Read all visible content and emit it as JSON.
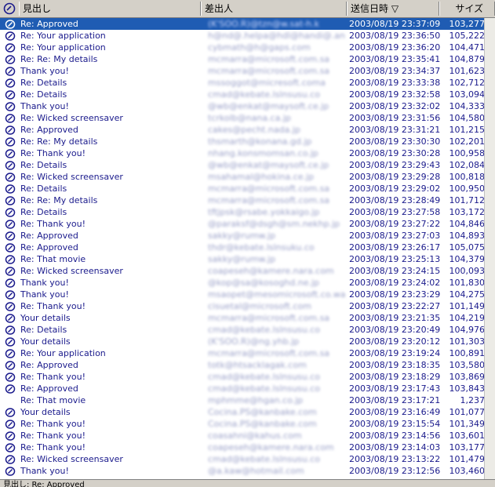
{
  "columns": {
    "subject": "見出し",
    "from": "差出人",
    "date": "送信日時 ▽",
    "size": "サイズ"
  },
  "rows": [
    {
      "subject": "Re: Approved",
      "from": "(K'SOO.R)@tzn@w.sat-h.k",
      "date": "2003/08/19 23:37:09",
      "size": "103,277",
      "selected": true
    },
    {
      "subject": "Re: Your application",
      "from": "h@nd@.helpa@hdl@handi@.ank.k",
      "date": "2003/08/19 23:36:50",
      "size": "105,222"
    },
    {
      "subject": "Re: Your application",
      "from": "cybmath@h@gaps.com",
      "date": "2003/08/19 23:36:20",
      "size": "104,471"
    },
    {
      "subject": "Re: Re: My details",
      "from": "mcmarra@microsoft.com.sa",
      "date": "2003/08/19 23:35:41",
      "size": "104,879"
    },
    {
      "subject": "Thank you!",
      "from": "mcmarra@microsoft.com.sa",
      "date": "2003/08/19 23:34:37",
      "size": "101,623"
    },
    {
      "subject": "Re: Details",
      "from": "mssoggot@micresoft.coma",
      "date": "2003/08/19 23:33:38",
      "size": "102,712"
    },
    {
      "subject": "Re: Details",
      "from": "cmad@kebate.lslnsusu.co",
      "date": "2003/08/19 23:32:58",
      "size": "103,094"
    },
    {
      "subject": "Thank you!",
      "from": "@wb@enkat@maysoft.ce.jp",
      "date": "2003/08/19 23:32:02",
      "size": "104,333"
    },
    {
      "subject": "Re: Wicked screensaver",
      "from": "tcrkolb@nana.ca.jp",
      "date": "2003/08/19 23:31:56",
      "size": "104,580"
    },
    {
      "subject": "Re: Approved",
      "from": "cakes@pecht.nada.jp",
      "date": "2003/08/19 23:31:21",
      "size": "101,215"
    },
    {
      "subject": "Re: Re: My details",
      "from": "thsmarth@konana.gd.jp",
      "date": "2003/08/19 23:30:30",
      "size": "102,201"
    },
    {
      "subject": "Re: Thank you!",
      "from": "nhang.konsmomsan.co.jp",
      "date": "2003/08/19 23:30:28",
      "size": "100,958"
    },
    {
      "subject": "Re: Details",
      "from": "@wb@enkat@maysoft.ce.jp",
      "date": "2003/08/19 23:29:43",
      "size": "102,084"
    },
    {
      "subject": "Re: Wicked screensaver",
      "from": "msahamal@hokina.ce.jp",
      "date": "2003/08/19 23:29:28",
      "size": "100,818"
    },
    {
      "subject": "Re: Details",
      "from": "mcmarra@microsoft.com.sa",
      "date": "2003/08/19 23:29:02",
      "size": "100,950"
    },
    {
      "subject": "Re: Re: My details",
      "from": "mcmarra@microsoft.com.sa",
      "date": "2003/08/19 23:28:49",
      "size": "101,712"
    },
    {
      "subject": "Re: Details",
      "from": "tftjpsk@rsabe.yokkaigo.jp",
      "date": "2003/08/19 23:27:58",
      "size": "103,172"
    },
    {
      "subject": "Re: Thank you!",
      "from": "@paraksf@dsgh@sm.nekhp.jp",
      "date": "2003/08/19 23:27:22",
      "size": "104,846"
    },
    {
      "subject": "Re: Approved",
      "from": "sakky@rumw.jp",
      "date": "2003/08/19 23:27:03",
      "size": "104,893"
    },
    {
      "subject": "Re: Approved",
      "from": "thdr@kebate.lslnsuku.co",
      "date": "2003/08/19 23:26:17",
      "size": "105,075"
    },
    {
      "subject": "Re: That movie",
      "from": "sakky@rumw.jp",
      "date": "2003/08/19 23:25:13",
      "size": "104,379"
    },
    {
      "subject": "Re: Wicked screensaver",
      "from": "coapeseh@kamere.nara.com",
      "date": "2003/08/19 23:24:15",
      "size": "100,093"
    },
    {
      "subject": "Thank you!",
      "from": "@kop@sa@kosoghd.ne.jp",
      "date": "2003/08/19 23:24:02",
      "size": "101,830"
    },
    {
      "subject": "Thank you!",
      "from": "msaopet@mesomicrosoft.co.wa",
      "date": "2003/08/19 23:23:29",
      "size": "104,275"
    },
    {
      "subject": "Re: Thank you!",
      "from": "cisuetal@microsoft.com",
      "date": "2003/08/19 23:22:27",
      "size": "101,149"
    },
    {
      "subject": "Your details",
      "from": "mcmarra@microsoft.com.sa",
      "date": "2003/08/19 23:21:35",
      "size": "104,219"
    },
    {
      "subject": "Re: Details",
      "from": "cmad@kebate.lslnsusu.co",
      "date": "2003/08/19 23:20:49",
      "size": "104,976"
    },
    {
      "subject": "Your details",
      "from": "(K'SOO.R)@ng.yhb.jp",
      "date": "2003/08/19 23:20:12",
      "size": "101,303"
    },
    {
      "subject": "Re: Your application",
      "from": "mcmarra@microsoft.com.sa",
      "date": "2003/08/19 23:19:24",
      "size": "100,891"
    },
    {
      "subject": "Re: Approved",
      "from": "totk@htsacklagak.com",
      "date": "2003/08/19 23:18:35",
      "size": "103,580"
    },
    {
      "subject": "Re: Thank you!",
      "from": "cmad@kebate.lslnsusu.co",
      "date": "2003/08/19 23:18:29",
      "size": "103,869"
    },
    {
      "subject": "Re: Approved",
      "from": "cmad@kebate.lslnsusu.co",
      "date": "2003/08/19 23:17:43",
      "size": "103,843"
    },
    {
      "subject": "Re: That movie",
      "from": "mphmme@hgan.co.jp",
      "date": "2003/08/19 23:17:21",
      "size": "1,237",
      "noicon": true
    },
    {
      "subject": "Your details",
      "from": "Cocina.PS@kanbake.com",
      "date": "2003/08/19 23:16:49",
      "size": "101,077"
    },
    {
      "subject": "Re: Thank you!",
      "from": "Cocina.PS@kanbake.com",
      "date": "2003/08/19 23:15:54",
      "size": "101,349"
    },
    {
      "subject": "Re: Thank you!",
      "from": "coasahni@kahus.com",
      "date": "2003/08/19 23:14:56",
      "size": "103,601"
    },
    {
      "subject": "Re: Thank you!",
      "from": "coapeseh@kamere.nara.com",
      "date": "2003/08/19 23:14:03",
      "size": "103,177"
    },
    {
      "subject": "Re: Wicked screensaver",
      "from": "cmad@kebate.lslnsusu.co",
      "date": "2003/08/19 23:13:22",
      "size": "101,479"
    },
    {
      "subject": "Thank you!",
      "from": "@a.kaw@hotmail.com",
      "date": "2003/08/19 23:12:56",
      "size": "103,460"
    }
  ],
  "status": "見出し: Re: Approved",
  "colors": {
    "selection": "#1f5cb3",
    "text": "#1a1a8c",
    "chrome": "#d4d0c8"
  }
}
